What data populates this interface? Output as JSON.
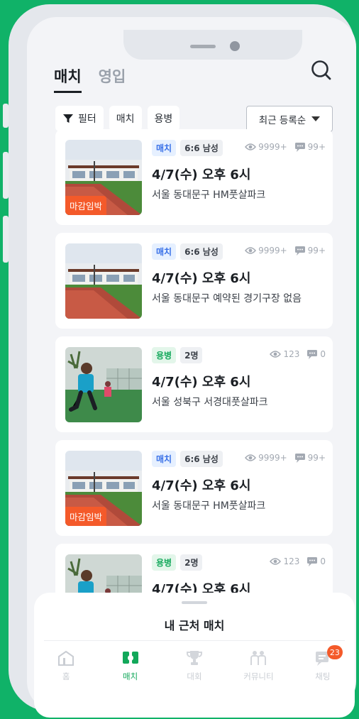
{
  "header": {
    "tabs": [
      {
        "label": "매치",
        "active": true
      },
      {
        "label": "영입",
        "active": false
      }
    ],
    "search_icon": "search-icon"
  },
  "filters": {
    "filter_label": "필터",
    "filter_icon": "funnel-icon",
    "chips": [
      "매치",
      "용병"
    ],
    "sort_label": "최근 등록순"
  },
  "cards": [
    {
      "type": "매치",
      "type_kind": "match",
      "condition": "6:6 남성",
      "views": "9999+",
      "comments": "99+",
      "title": "4/7(수) 오후 6시",
      "location": "서울 동대문구 HM풋살파크",
      "closing": "마감임박",
      "image": "stadium"
    },
    {
      "type": "매치",
      "type_kind": "match",
      "condition": "6:6 남성",
      "views": "9999+",
      "comments": "99+",
      "title": "4/7(수) 오후 6시",
      "location": "서울 동대문구 예약된 경기구장 없음",
      "closing": "",
      "image": "stadium"
    },
    {
      "type": "용병",
      "type_kind": "merc",
      "condition": "2명",
      "views": "123",
      "comments": "0",
      "title": "4/7(수) 오후 6시",
      "location": "서울 성북구 서경대풋살파크",
      "closing": "",
      "image": "player"
    },
    {
      "type": "매치",
      "type_kind": "match",
      "condition": "6:6 남성",
      "views": "9999+",
      "comments": "99+",
      "title": "4/7(수) 오후 6시",
      "location": "서울 동대문구 HM풋살파크",
      "closing": "마감임박",
      "image": "stadium"
    },
    {
      "type": "용병",
      "type_kind": "merc",
      "condition": "2명",
      "views": "123",
      "comments": "0",
      "title": "4/7(수) 오후 6시",
      "location": "",
      "closing": "",
      "image": "player"
    }
  ],
  "sheet": {
    "title": "내 근처 매치"
  },
  "nav": [
    {
      "label": "홈",
      "icon": "home-icon",
      "active": false
    },
    {
      "label": "매치",
      "icon": "match-icon",
      "active": true
    },
    {
      "label": "대회",
      "icon": "trophy-icon",
      "active": false
    },
    {
      "label": "커뮤니티",
      "icon": "community-icon",
      "active": false
    },
    {
      "label": "채팅",
      "icon": "chat-icon",
      "active": false,
      "badge": "23"
    }
  ],
  "colors": {
    "brand": "#10b268",
    "accent": "#12a85a",
    "match": "#3971e8",
    "closing": "#f45a2a"
  }
}
